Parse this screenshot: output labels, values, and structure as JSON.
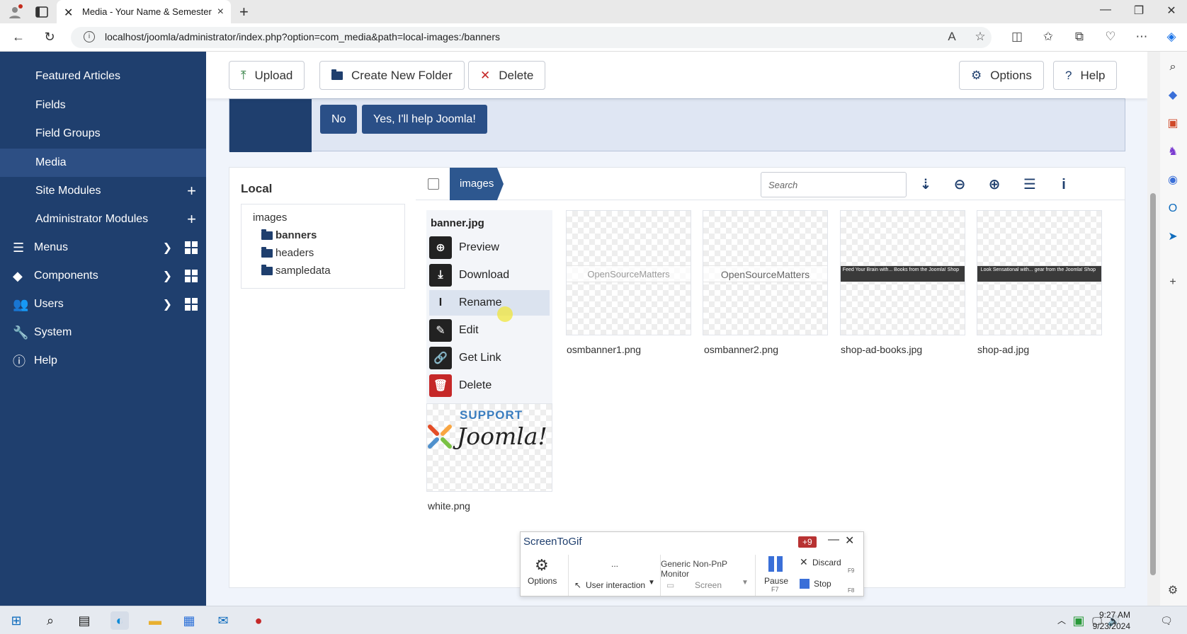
{
  "browser": {
    "tab_title": "Media - Your Name & Semester y",
    "url": "localhost/joomla/administrator/index.php?option=com_media&path=local-images:/banners"
  },
  "sidebar": {
    "items": [
      {
        "label": "Featured Articles"
      },
      {
        "label": "Fields"
      },
      {
        "label": "Field Groups"
      },
      {
        "label": "Media"
      },
      {
        "label": "Site Modules"
      },
      {
        "label": "Administrator Modules"
      },
      {
        "label": "Menus"
      },
      {
        "label": "Components"
      },
      {
        "label": "Users"
      },
      {
        "label": "System"
      },
      {
        "label": "Help"
      }
    ]
  },
  "toolbar": {
    "upload": "Upload",
    "new_folder": "Create New Folder",
    "delete": "Delete",
    "options": "Options",
    "help": "Help"
  },
  "stats_banner": {
    "no": "No",
    "yes": "Yes, I'll help Joomla!"
  },
  "media": {
    "local_title": "Local",
    "tree": {
      "root": "images",
      "folders": [
        "banners",
        "headers",
        "sampledata"
      ]
    },
    "breadcrumb": "images",
    "search_placeholder": "Search",
    "context_menu": {
      "file": "banner.jpg",
      "items": [
        "Preview",
        "Download",
        "Rename",
        "Edit",
        "Get Link",
        "Delete"
      ]
    },
    "files": [
      {
        "name": "osmbanner1.png",
        "preview": "OpenSourceMatters"
      },
      {
        "name": "osmbanner2.png",
        "preview": "OpenSourceMatters"
      },
      {
        "name": "shop-ad-books.jpg",
        "preview": "Feed Your Brain with... Books from the Joomla! Shop"
      },
      {
        "name": "shop-ad.jpg",
        "preview": "Look Sensational with... gear from the Joomla! Shop"
      }
    ],
    "white_png": {
      "name": "white.png",
      "support": "SUPPORT",
      "logo": "Joomla!"
    }
  },
  "screentogif": {
    "title": "ScreenToGif",
    "badge": "+9",
    "options": "Options",
    "ellipsis": "...",
    "user_interaction": "User interaction",
    "monitor": "Generic Non-PnP Monitor",
    "screen": "Screen",
    "pause": "Pause",
    "pause_key": "F7",
    "discard": "Discard",
    "discard_key": "F9",
    "stop": "Stop",
    "stop_key": "F8"
  },
  "taskbar": {
    "time": "9:27 AM",
    "date": "9/23/2024"
  }
}
